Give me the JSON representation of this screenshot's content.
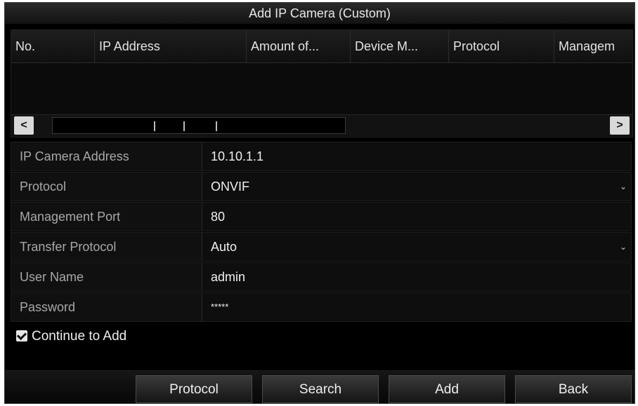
{
  "window": {
    "title": "Add IP Camera (Custom)"
  },
  "table": {
    "columns": [
      "No.",
      "IP Address",
      "Amount of...",
      "Device M...",
      "Protocol",
      "Managem"
    ],
    "scroll_left": "<",
    "scroll_right": ">"
  },
  "form": {
    "ip_camera_address": {
      "label": "IP Camera Address",
      "value": "10.10.1.1"
    },
    "protocol": {
      "label": "Protocol",
      "value": "ONVIF",
      "caret": "⌄"
    },
    "management_port": {
      "label": "Management Port",
      "value": "80"
    },
    "transfer_protocol": {
      "label": "Transfer Protocol",
      "value": "Auto",
      "caret": "⌄"
    },
    "user_name": {
      "label": "User Name",
      "value": "admin"
    },
    "password": {
      "label": "Password",
      "value": "*****"
    }
  },
  "continue_to_add": {
    "label": "Continue to Add",
    "checked": true
  },
  "buttons": {
    "protocol": "Protocol",
    "search": "Search",
    "add": "Add",
    "back": "Back"
  },
  "icons": {
    "checkbox": "checkbox-checked-icon",
    "dropdown": "chevron-down-icon"
  }
}
